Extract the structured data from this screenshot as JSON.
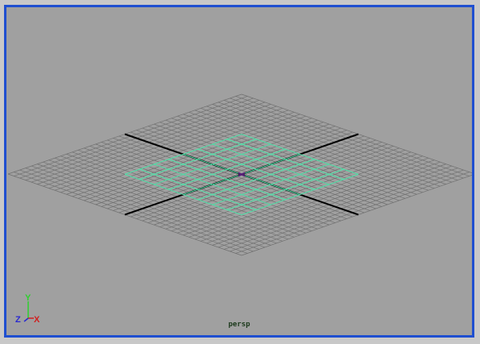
{
  "viewport": {
    "camera_name": "persp",
    "active_border_color": "#1f4fd0",
    "background_color": "#a0a0a0",
    "grid_color": "#6f6f6f",
    "axis_line_color": "#000000",
    "selected_plane_color": "#4fe0a8"
  },
  "axis_gizmo": {
    "y_label": "Y",
    "z_label": "Z",
    "x_label": "X",
    "y_color": "#2fd02f",
    "z_color": "#2a2ad0",
    "x_color": "#d02020"
  }
}
